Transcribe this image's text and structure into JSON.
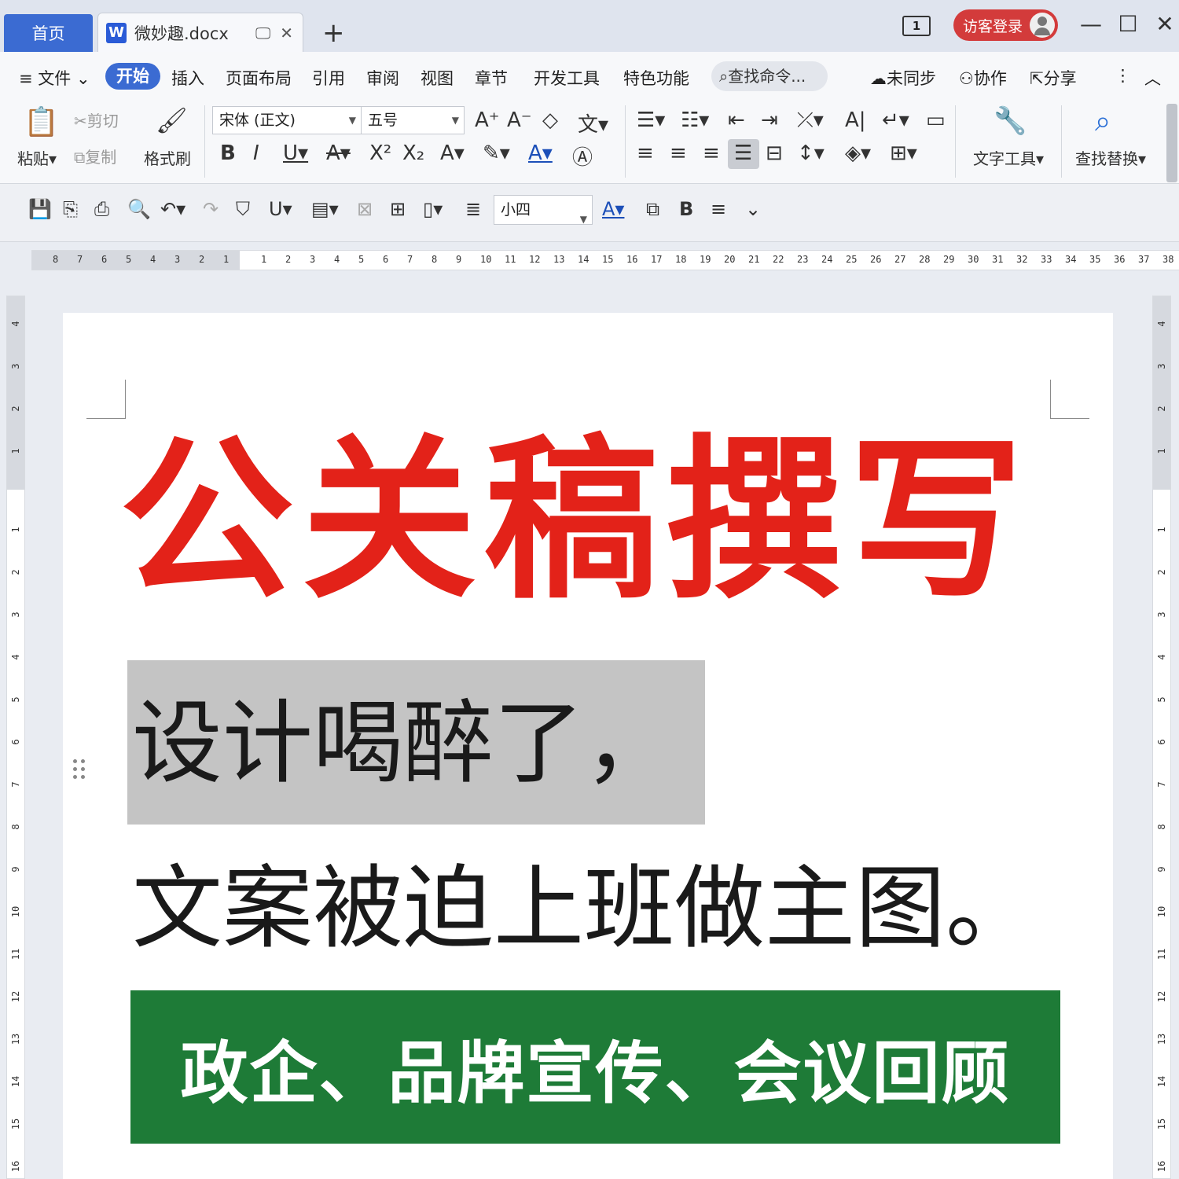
{
  "titlebar": {
    "home_tab": "首页",
    "doc_tab": "微妙趣.docx",
    "doc_icon": "W",
    "layout_icon": "1",
    "visitor_login": "访客登录"
  },
  "menu": {
    "file": "≡ 文件",
    "items": [
      "开始",
      "插入",
      "页面布局",
      "引用",
      "审阅",
      "视图",
      "章节",
      "开发工具",
      "特色功能"
    ],
    "search": "查找命令...",
    "sync": "未同步",
    "collab": "协作",
    "share": "分享"
  },
  "ribbon": {
    "paste": "粘贴",
    "cut": "剪切",
    "copy": "复制",
    "format_painter": "格式刷",
    "font_name": "宋体 (正文)",
    "font_size": "五号",
    "text_tools": "文字工具",
    "find_replace": "查找替换"
  },
  "quickbar": {
    "font_size": "小四"
  },
  "ruler": {
    "horizontal_left": [
      "8",
      "7",
      "6",
      "5",
      "4",
      "3",
      "2",
      "1"
    ],
    "horizontal_right": [
      "1",
      "2",
      "3",
      "4",
      "5",
      "6",
      "7",
      "8",
      "9",
      "10",
      "11",
      "12",
      "13",
      "14",
      "15",
      "16",
      "17",
      "18",
      "19",
      "20",
      "21",
      "22",
      "23",
      "24",
      "25",
      "26",
      "27",
      "28",
      "29",
      "30",
      "31",
      "32",
      "33",
      "34",
      "35",
      "36",
      "37",
      "38"
    ],
    "vertical_top": [
      "4",
      "3",
      "2",
      "1"
    ],
    "vertical_body": [
      "1",
      "2",
      "3",
      "4",
      "5",
      "6",
      "7",
      "8",
      "9",
      "10",
      "11",
      "12",
      "13",
      "14",
      "15",
      "16"
    ]
  },
  "document": {
    "headline": "公关稿撰写",
    "line1": "设计喝醉了，",
    "line2": "文案被迫上班做主图。",
    "banner": "政企、品牌宣传、会议回顾"
  },
  "colors": {
    "accent_blue": "#3b6bd2",
    "headline_red": "#e32219",
    "banner_green": "#1e7b37",
    "highlight_gray": "#c4c4c4"
  }
}
